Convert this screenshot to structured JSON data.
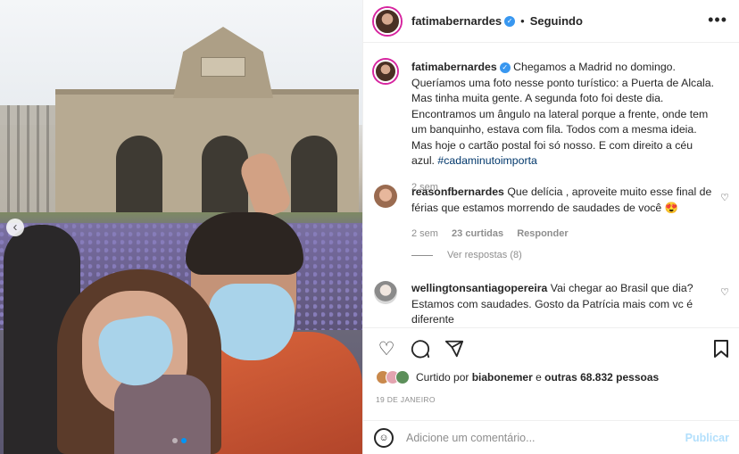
{
  "post": {
    "photo_alt": "",
    "carousel": {
      "count": 2,
      "active": 1
    }
  },
  "header": {
    "username": "fatimabernardes",
    "separator": "•",
    "follow_status": "Seguindo"
  },
  "caption": {
    "username": "fatimabernardes",
    "text": "Chegamos a Madrid no domingo. Queríamos uma foto nesse ponto turístico: a Puerta de Alcala. Mas tinha muita gente. A segunda foto foi deste dia. Encontramos um ângulo na lateral porque a frente, onde tem um banquinho, estava com fila. Todos com a mesma ideia. Mas hoje o cartão postal foi só nosso. E com direito a céu azul. ",
    "hashtag": "#cadaminutoimporta",
    "time": "2 sem"
  },
  "comments": [
    {
      "username": "reasonfbernardes",
      "text": "Que delícia , aproveite muito esse final de férias que estamos morrendo de saudades de você 😍",
      "time": "2 sem",
      "likes": "23 curtidas",
      "reply": "Responder",
      "view_replies": "Ver respostas (8)"
    },
    {
      "username": "wellingtonsantiagopereira",
      "text": "Vai chegar ao Brasil que dia? Estamos com saudades. Gosto da Patrícia mais com vc é diferente"
    }
  ],
  "likes": {
    "prefix": "Curtido por",
    "user": "biabonemer",
    "middle": "e",
    "others": "outras 68.832 pessoas"
  },
  "date": "19 DE JANEIRO",
  "composer": {
    "placeholder": "Adicione um comentário...",
    "publish": "Publicar"
  },
  "colors": {
    "link_blue": "#00376b",
    "accent_blue": "#0095f6",
    "publish_disabled": "#b2dffc",
    "secondary_text": "#8e8e8e"
  },
  "icons": [
    "more-options-icon",
    "verified-icon",
    "heart-icon",
    "comment-icon",
    "share-icon",
    "bookmark-icon",
    "emoji-icon",
    "chevron-left-icon"
  ]
}
